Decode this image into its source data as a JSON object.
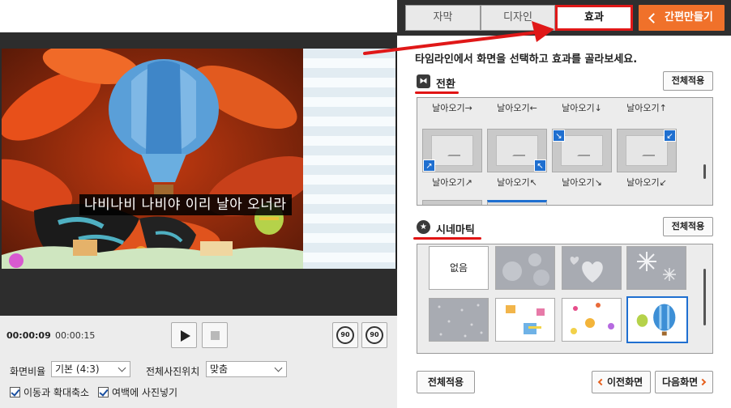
{
  "preview": {
    "subtitle": "나비나비 나비야 이리 날아 오너라"
  },
  "player": {
    "time_current": "00:00:09",
    "time_total": "00:00:15",
    "rotate_left_label": "90",
    "rotate_right_label": "90"
  },
  "settings": {
    "ratio_label": "화면비율",
    "ratio_value": "기본 (4:3)",
    "photo_position_label": "전체사진위치",
    "photo_position_value": "맞춤",
    "move_zoom_label": "이동과 확대축소",
    "margin_label": "여백에 사진넣기"
  },
  "tabs": {
    "subtitle": "자막",
    "design": "디자인",
    "effect": "효과",
    "quick_make": "간편만들기"
  },
  "panel": {
    "instruction": "타임라인에서 화면을 선택하고 효과를 골라보세요.",
    "transition_title": "전환",
    "cinematic_title": "시네마틱",
    "apply_all": "전체적용",
    "prev": "이전화면",
    "next": "다음화면"
  },
  "transitions": {
    "row1_labels": [
      "날아오기→",
      "날아오기←",
      "날아오기↓",
      "날아오기↑"
    ],
    "row2_labels": [
      "날아오기↗",
      "날아오기↖",
      "날아오기↘",
      "날아오기↙"
    ]
  },
  "cinematic": {
    "none_label": "없음"
  },
  "colors": {
    "accent_orange": "#f0712a",
    "annotation_red": "#e01818",
    "selection_blue": "#1f6fd0"
  }
}
